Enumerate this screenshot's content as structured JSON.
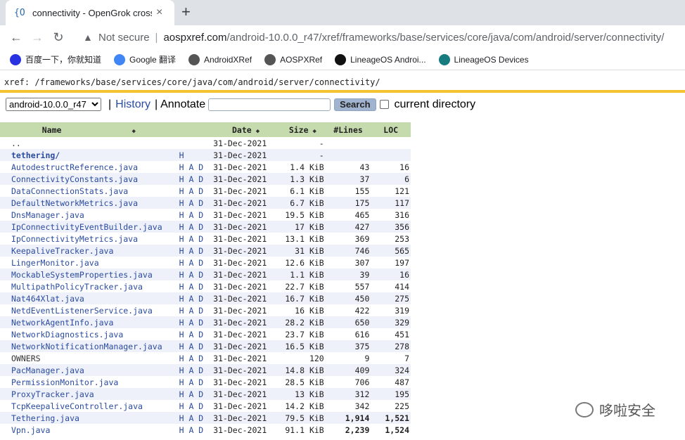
{
  "tab": {
    "favicon": "{O",
    "title": "connectivity - OpenGrok cross",
    "close": "×",
    "new_tab": "+"
  },
  "toolbar": {
    "back": "←",
    "forward": "→",
    "reload": "↻",
    "security_label": "Not secure",
    "url_host": "aospxref.com",
    "url_path": "/android-10.0.0_r47/xref/frameworks/base/services/core/java/com/android/server/connectivity/"
  },
  "bookmarks": [
    {
      "label": "百度一下，你就知道",
      "icon": "baidu-icon",
      "color": "#2932e1"
    },
    {
      "label": "Google 翻译",
      "icon": "google-translate-icon",
      "color": "#4285f4"
    },
    {
      "label": "AndroidXRef",
      "icon": "globe-icon",
      "color": "#555555"
    },
    {
      "label": "AOSPXRef",
      "icon": "globe-icon",
      "color": "#555555"
    },
    {
      "label": "LineageOS Androi...",
      "icon": "github-icon",
      "color": "#111111"
    },
    {
      "label": "LineageOS Devices",
      "icon": "lineage-icon",
      "color": "#167c80"
    }
  ],
  "xref_path": "xref: /frameworks/base/services/core/java/com/android/server/connectivity/",
  "controls": {
    "version": "android-10.0.0_r47",
    "history": "History",
    "annotate": "Annotate",
    "search_value": "",
    "search_button": "Search",
    "current_directory": "current directory"
  },
  "table": {
    "headers": {
      "name": "Name",
      "date": "Date",
      "size": "Size",
      "lines": "#Lines",
      "loc": "LOC"
    },
    "rows": [
      {
        "name": "..",
        "had": "",
        "date": "31-Dec-2021",
        "size": "-",
        "lines": "",
        "loc": ""
      },
      {
        "name": "tethering/",
        "had": "H",
        "date": "31-Dec-2021",
        "size": "-",
        "lines": "",
        "loc": ""
      },
      {
        "name": "AutodestructReference.java",
        "had": "H A D",
        "date": "31-Dec-2021",
        "size": "1.4 KiB",
        "lines": "43",
        "loc": "16"
      },
      {
        "name": "ConnectivityConstants.java",
        "had": "H A D",
        "date": "31-Dec-2021",
        "size": "1.3 KiB",
        "lines": "37",
        "loc": "6"
      },
      {
        "name": "DataConnectionStats.java",
        "had": "H A D",
        "date": "31-Dec-2021",
        "size": "6.1 KiB",
        "lines": "155",
        "loc": "121"
      },
      {
        "name": "DefaultNetworkMetrics.java",
        "had": "H A D",
        "date": "31-Dec-2021",
        "size": "6.7 KiB",
        "lines": "175",
        "loc": "117"
      },
      {
        "name": "DnsManager.java",
        "had": "H A D",
        "date": "31-Dec-2021",
        "size": "19.5 KiB",
        "lines": "465",
        "loc": "316"
      },
      {
        "name": "IpConnectivityEventBuilder.java",
        "had": "H A D",
        "date": "31-Dec-2021",
        "size": "17 KiB",
        "lines": "427",
        "loc": "356"
      },
      {
        "name": "IpConnectivityMetrics.java",
        "had": "H A D",
        "date": "31-Dec-2021",
        "size": "13.1 KiB",
        "lines": "369",
        "loc": "253"
      },
      {
        "name": "KeepaliveTracker.java",
        "had": "H A D",
        "date": "31-Dec-2021",
        "size": "31 KiB",
        "lines": "746",
        "loc": "565"
      },
      {
        "name": "LingerMonitor.java",
        "had": "H A D",
        "date": "31-Dec-2021",
        "size": "12.6 KiB",
        "lines": "307",
        "loc": "197"
      },
      {
        "name": "MockableSystemProperties.java",
        "had": "H A D",
        "date": "31-Dec-2021",
        "size": "1.1 KiB",
        "lines": "39",
        "loc": "16"
      },
      {
        "name": "MultipathPolicyTracker.java",
        "had": "H A D",
        "date": "31-Dec-2021",
        "size": "22.7 KiB",
        "lines": "557",
        "loc": "414"
      },
      {
        "name": "Nat464Xlat.java",
        "had": "H A D",
        "date": "31-Dec-2021",
        "size": "16.7 KiB",
        "lines": "450",
        "loc": "275"
      },
      {
        "name": "NetdEventListenerService.java",
        "had": "H A D",
        "date": "31-Dec-2021",
        "size": "16 KiB",
        "lines": "422",
        "loc": "319"
      },
      {
        "name": "NetworkAgentInfo.java",
        "had": "H A D",
        "date": "31-Dec-2021",
        "size": "28.2 KiB",
        "lines": "650",
        "loc": "329"
      },
      {
        "name": "NetworkDiagnostics.java",
        "had": "H A D",
        "date": "31-Dec-2021",
        "size": "23.7 KiB",
        "lines": "616",
        "loc": "451"
      },
      {
        "name": "NetworkNotificationManager.java",
        "had": "H A D",
        "date": "31-Dec-2021",
        "size": "16.5 KiB",
        "lines": "375",
        "loc": "278"
      },
      {
        "name": "OWNERS",
        "had": "H A D",
        "date": "31-Dec-2021",
        "size": "120",
        "lines": "9",
        "loc": "7"
      },
      {
        "name": "PacManager.java",
        "had": "H A D",
        "date": "31-Dec-2021",
        "size": "14.8 KiB",
        "lines": "409",
        "loc": "324"
      },
      {
        "name": "PermissionMonitor.java",
        "had": "H A D",
        "date": "31-Dec-2021",
        "size": "28.5 KiB",
        "lines": "706",
        "loc": "487"
      },
      {
        "name": "ProxyTracker.java",
        "had": "H A D",
        "date": "31-Dec-2021",
        "size": "13 KiB",
        "lines": "312",
        "loc": "195"
      },
      {
        "name": "TcpKeepaliveController.java",
        "had": "H A D",
        "date": "31-Dec-2021",
        "size": "14.2 KiB",
        "lines": "342",
        "loc": "225"
      },
      {
        "name": "Tethering.java",
        "had": "H A D",
        "date": "31-Dec-2021",
        "size": "79.5 KiB",
        "lines": "1,914",
        "loc": "1,521"
      },
      {
        "name": "Vpn.java",
        "had": "H A D",
        "date": "31-Dec-2021",
        "size": "91.1 KiB",
        "lines": "2,239",
        "loc": "1,524"
      }
    ]
  },
  "watermark": {
    "text": "哆啦安全"
  }
}
